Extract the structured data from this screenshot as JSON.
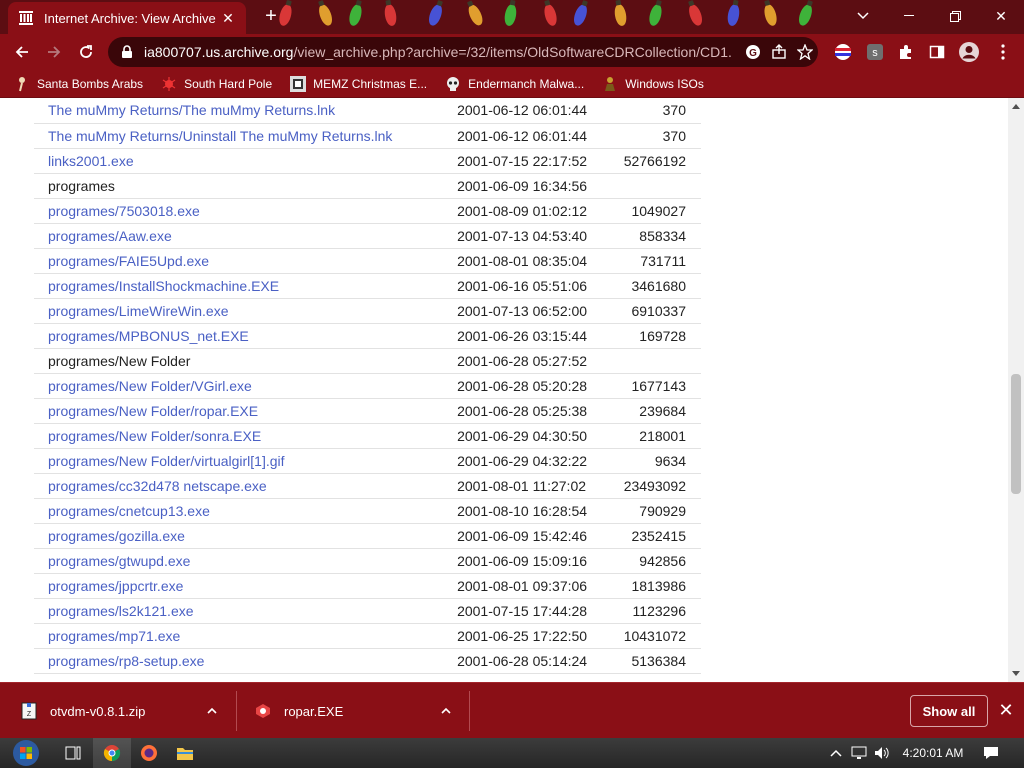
{
  "browser": {
    "tab_title": "Internet Archive: View Archive",
    "url_host": "ia800707.us.archive.org",
    "url_path": "/view_archive.php?archive=/32/items/OldSoftwareCDRCollection/CD1."
  },
  "bookmarks": [
    {
      "label": "Santa Bombs Arabs",
      "icon": "pin-icon"
    },
    {
      "label": "South Hard Pole",
      "icon": "bug-icon"
    },
    {
      "label": "MEMZ Christmas E...",
      "icon": "memz-icon"
    },
    {
      "label": "Endermanch Malwa...",
      "icon": "skull-icon"
    },
    {
      "label": "Windows ISOs",
      "icon": "figure-icon"
    }
  ],
  "files": [
    {
      "name": "The muMmy Returns/The muMmy Returns.lnk",
      "date": "2001-06-12 06:01:44",
      "size": "370",
      "link": true
    },
    {
      "name": "The muMmy Returns/Uninstall The muMmy Returns.lnk",
      "date": "2001-06-12 06:01:44",
      "size": "370",
      "link": true
    },
    {
      "name": "links2001.exe",
      "date": "2001-07-15 22:17:52",
      "size": "52766192",
      "link": true
    },
    {
      "name": "programes",
      "date": "2001-06-09 16:34:56",
      "size": "",
      "link": false
    },
    {
      "name": "programes/7503018.exe",
      "date": "2001-08-09 01:02:12",
      "size": "1049027",
      "link": true
    },
    {
      "name": "programes/Aaw.exe",
      "date": "2001-07-13 04:53:40",
      "size": "858334",
      "link": true
    },
    {
      "name": "programes/FAIE5Upd.exe",
      "date": "2001-08-01 08:35:04",
      "size": "731711",
      "link": true
    },
    {
      "name": "programes/InstallShockmachine.EXE",
      "date": "2001-06-16 05:51:06",
      "size": "3461680",
      "link": true
    },
    {
      "name": "programes/LimeWireWin.exe",
      "date": "2001-07-13 06:52:00",
      "size": "6910337",
      "link": true
    },
    {
      "name": "programes/MPBONUS_net.EXE",
      "date": "2001-06-26 03:15:44",
      "size": "169728",
      "link": true
    },
    {
      "name": "programes/New Folder",
      "date": "2001-06-28 05:27:52",
      "size": "",
      "link": false
    },
    {
      "name": "programes/New Folder/VGirl.exe",
      "date": "2001-06-28 05:20:28",
      "size": "1677143",
      "link": true
    },
    {
      "name": "programes/New Folder/ropar.EXE",
      "date": "2001-06-28 05:25:38",
      "size": "239684",
      "link": true
    },
    {
      "name": "programes/New Folder/sonra.EXE",
      "date": "2001-06-29 04:30:50",
      "size": "218001",
      "link": true
    },
    {
      "name": "programes/New Folder/virtualgirl[1].gif",
      "date": "2001-06-29 04:32:22",
      "size": "9634",
      "link": true
    },
    {
      "name": "programes/cc32d478 netscape.exe",
      "date": "2001-08-01 11:27:02",
      "size": "23493092",
      "link": true
    },
    {
      "name": "programes/cnetcup13.exe",
      "date": "2001-08-10 16:28:54",
      "size": "790929",
      "link": true
    },
    {
      "name": "programes/gozilla.exe",
      "date": "2001-06-09 15:42:46",
      "size": "2352415",
      "link": true
    },
    {
      "name": "programes/gtwupd.exe",
      "date": "2001-06-09 15:09:16",
      "size": "942856",
      "link": true
    },
    {
      "name": "programes/jppcrtr.exe",
      "date": "2001-08-01 09:37:06",
      "size": "1813986",
      "link": true
    },
    {
      "name": "programes/ls2k121.exe",
      "date": "2001-07-15 17:44:28",
      "size": "1123296",
      "link": true
    },
    {
      "name": "programes/mp71.exe",
      "date": "2001-06-25 17:22:50",
      "size": "10431072",
      "link": true
    },
    {
      "name": "programes/rp8-setup.exe",
      "date": "2001-06-28 05:14:24",
      "size": "5136384",
      "link": true
    }
  ],
  "downloads": [
    {
      "name": "otvdm-v0.8.1.zip",
      "icon": "zip-icon"
    },
    {
      "name": "ropar.EXE",
      "icon": "exe-icon"
    }
  ],
  "shelf": {
    "show_all": "Show all"
  },
  "taskbar": {
    "clock": "4:20:01 AM"
  },
  "colors": {
    "theme": "#8a0f16",
    "tabstrip": "#5c0d12",
    "link": "#4a60c4"
  }
}
